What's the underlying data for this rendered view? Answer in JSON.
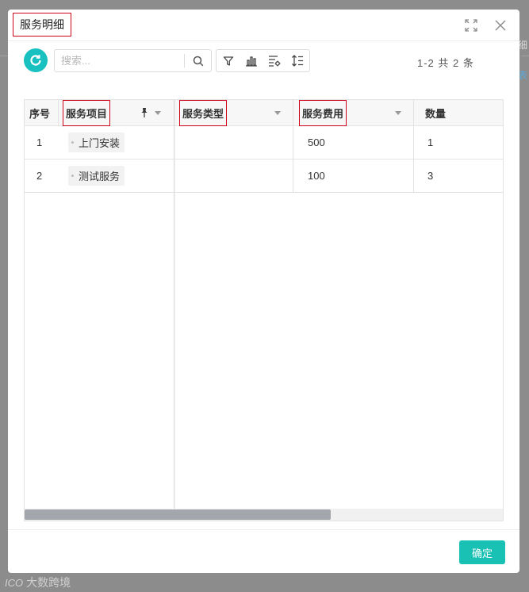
{
  "modal": {
    "title": "服务明细",
    "confirm_label": "确定"
  },
  "toolbar": {
    "search_placeholder": "搜索...",
    "pager_text": "1-2 共 2 条"
  },
  "table": {
    "columns": [
      {
        "label": "序号"
      },
      {
        "label": "服务项目"
      },
      {
        "label": "服务类型"
      },
      {
        "label": "服务费用"
      },
      {
        "label": "数量"
      }
    ],
    "rows": [
      {
        "index": "1",
        "item": "上门安装",
        "type": "",
        "fee": "500",
        "qty": "1"
      },
      {
        "index": "2",
        "item": "测试服务",
        "type": "",
        "fee": "100",
        "qty": "3"
      }
    ]
  },
  "watermark": {
    "logo": "ICO",
    "text": "大数跨境"
  },
  "background": {
    "right_fragment_1": "细",
    "right_fragment_2": "表"
  },
  "colors": {
    "accent": "#19c0b4",
    "highlight_box": "#d0021b"
  },
  "icons": {
    "refresh": "refresh-icon",
    "search": "search-icon",
    "filter": "filter-icon",
    "chart": "bar-chart-icon",
    "columns": "column-settings-icon",
    "row_height": "row-height-icon",
    "expand": "fullscreen-icon",
    "close": "close-icon",
    "pin": "pin-icon"
  }
}
